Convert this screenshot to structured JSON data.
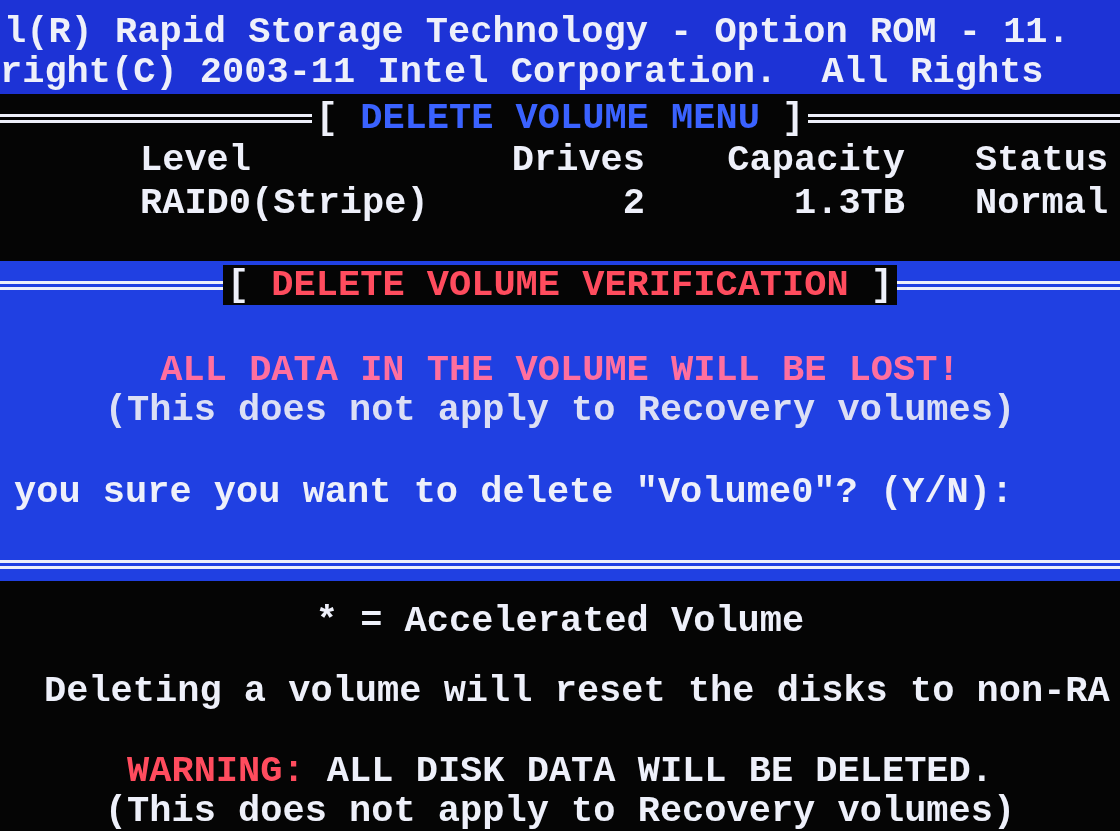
{
  "header": {
    "lines": [
      "l(R) Rapid Storage Technology - Option ROM - 11.",
      "right(C) 2003-11 Intel Corporation.  All Rights "
    ]
  },
  "volume_menu": {
    "title_open": "[",
    "title": "DELETE VOLUME MENU",
    "title_close": "]",
    "columns": [
      "Level",
      "Drives",
      "Capacity",
      "Status"
    ],
    "rows": [
      [
        "RAID0(Stripe)",
        "2",
        "1.3TB",
        "Normal"
      ]
    ]
  },
  "verification": {
    "title_open": "[",
    "title": "DELETE VOLUME VERIFICATION",
    "title_close": "]",
    "warning": "ALL DATA IN THE VOLUME WILL BE LOST!",
    "note": "(This does not apply to Recovery volumes)",
    "prompt": "you sure you want to delete \"Volume0\"? (Y/N):"
  },
  "footer": {
    "legend": "* = Accelerated Volume",
    "info": "Deleting a volume will reset the disks to non-RA",
    "warning_label": "WARNING:",
    "warning_text": "ALL DISK DATA WILL BE DELETED.",
    "note": "(This does not apply to Recovery volumes)"
  }
}
